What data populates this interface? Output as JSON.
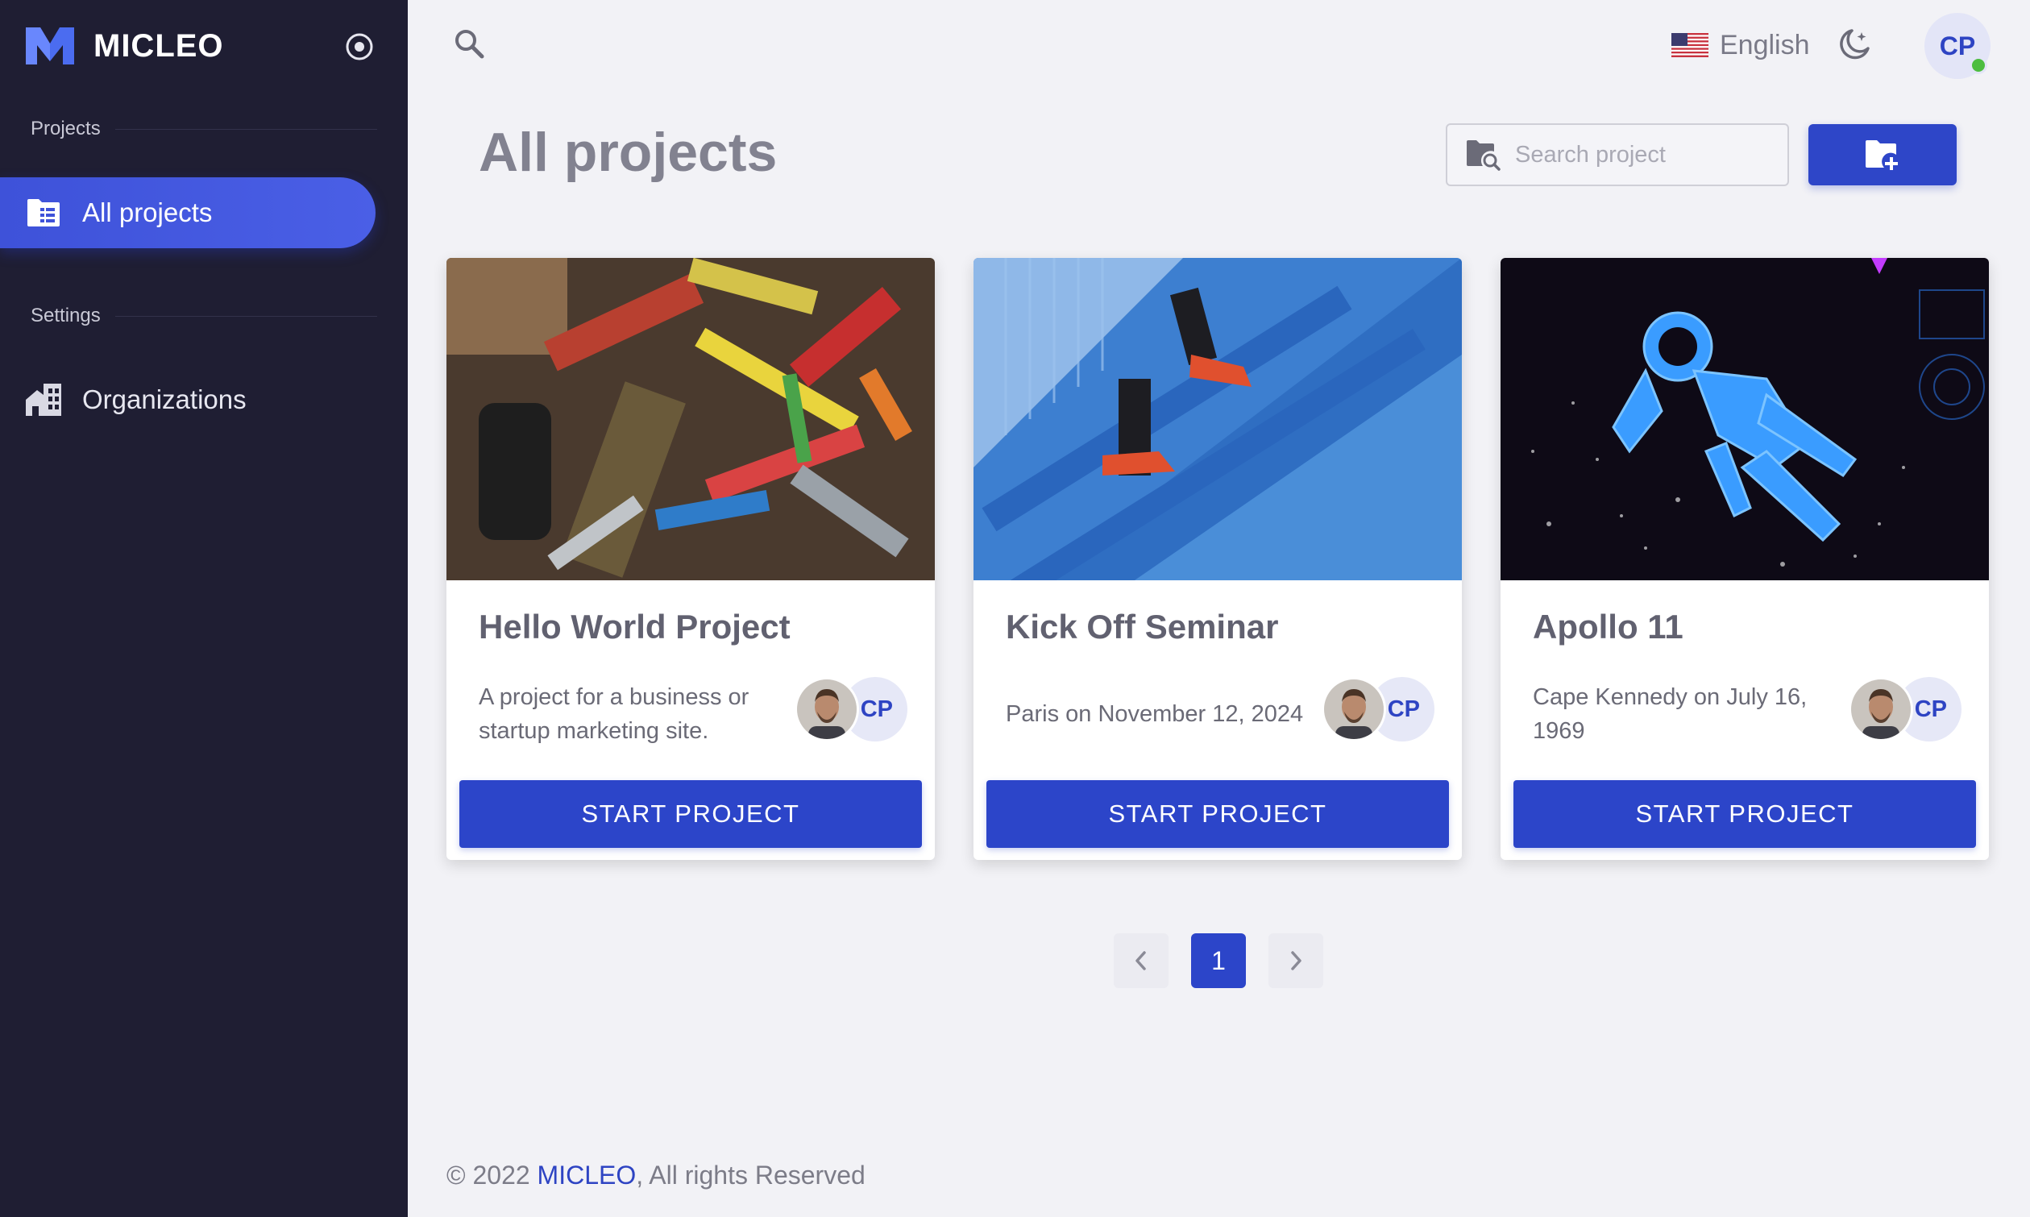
{
  "brand": {
    "name": "MICLEO",
    "logo_icon": "micleo-logo-icon"
  },
  "sidebar": {
    "collapse_icon": "radio-circle-icon",
    "sections": [
      {
        "label": "Projects"
      },
      {
        "label": "Settings"
      }
    ],
    "items": [
      {
        "label": "All projects",
        "icon": "folder-list-icon",
        "active": true
      },
      {
        "label": "Organizations",
        "icon": "buildings-icon",
        "active": false
      }
    ]
  },
  "topbar": {
    "search_icon": "search-icon",
    "language": {
      "label": "English",
      "flag": "us-flag-icon"
    },
    "theme_icon": "moon-stars-icon",
    "user_initials": "CP",
    "user_status": "online"
  },
  "header": {
    "title": "All projects",
    "search": {
      "placeholder": "Search project",
      "value": ""
    },
    "new_project_icon": "folder-plus-icon"
  },
  "projects": [
    {
      "title": "Hello World Project",
      "description": "A project for a business or startup marketing site.",
      "member_initials": "CP",
      "button_label": "START PROJECT"
    },
    {
      "title": "Kick Off Seminar",
      "description": "Paris on November 12, 2024",
      "member_initials": "CP",
      "button_label": "START PROJECT"
    },
    {
      "title": "Apollo 11",
      "description": "Cape Kennedy on July 16, 1969",
      "member_initials": "CP",
      "button_label": "START PROJECT"
    }
  ],
  "pagination": {
    "prev_icon": "chevron-left-icon",
    "current_page": "1",
    "next_icon": "chevron-right-icon"
  },
  "footer": {
    "prefix": "© 2022 ",
    "brand_link": "MICLEO",
    "suffix": ", All rights Reserved"
  },
  "colors": {
    "sidebar_bg": "#1f1e33",
    "accent": "#2e46c8",
    "page_bg": "#f2f2f6",
    "online": "#4dbd3f"
  }
}
